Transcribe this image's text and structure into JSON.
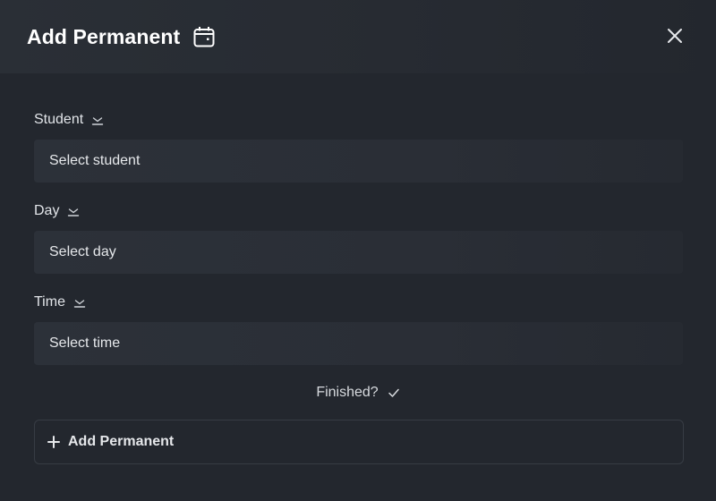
{
  "dialog": {
    "title": "Add Permanent",
    "title_icon": "calendar-icon",
    "close_icon": "close-icon"
  },
  "fields": [
    {
      "label": "Student",
      "placeholder": "Select student",
      "icon": "chevron-down-icon"
    },
    {
      "label": "Day",
      "placeholder": "Select day",
      "icon": "chevron-down-icon"
    },
    {
      "label": "Time",
      "placeholder": "Select time",
      "icon": "chevron-down-icon"
    }
  ],
  "finished": {
    "label": "Finished?",
    "icon": "check-icon"
  },
  "add_button": {
    "label": "Add Permanent",
    "icon": "plus-icon"
  },
  "colors": {
    "background": "#23272e",
    "header": "#2a2f36",
    "field": "#2c3139",
    "text": "#e6e8eb"
  }
}
